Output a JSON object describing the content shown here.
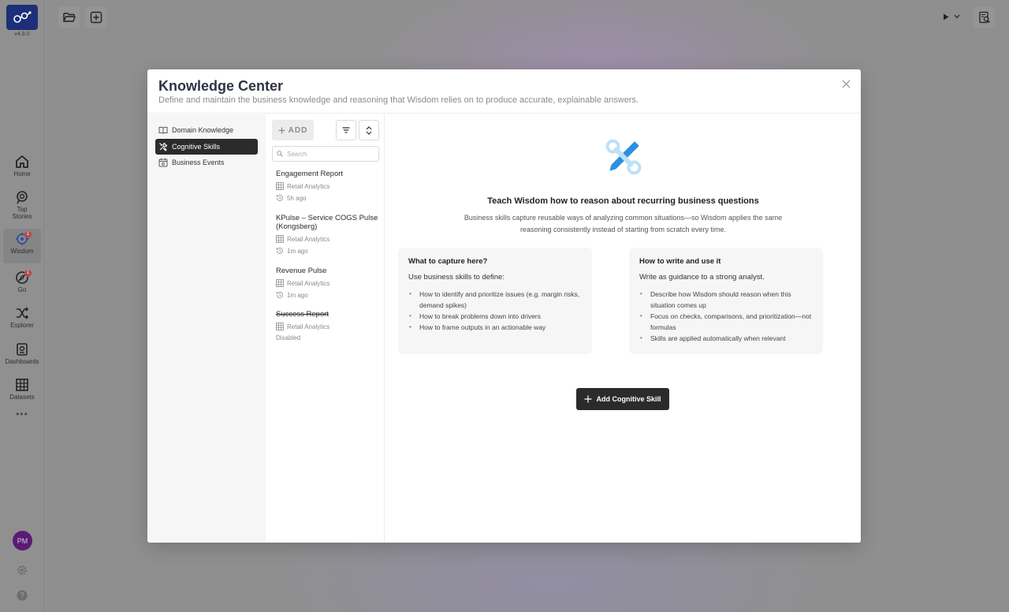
{
  "app": {
    "version": "v4.9.0",
    "rail": [
      {
        "label": "Home",
        "icon": "home-icon"
      },
      {
        "label": "Top Stories",
        "icon": "stories-icon"
      },
      {
        "label": "Wisdom",
        "icon": "wisdom-icon",
        "active": true,
        "badge": "1"
      },
      {
        "label": "Go",
        "icon": "compass-icon",
        "badge": "1"
      },
      {
        "label": "Explorer",
        "icon": "shuffle-icon"
      },
      {
        "label": "Dashboards",
        "icon": "dashboard-icon"
      },
      {
        "label": "Datasets",
        "icon": "table-icon"
      }
    ],
    "more": "•••",
    "avatar_initials": "PM"
  },
  "modal": {
    "title": "Knowledge Center",
    "subtitle": "Define and maintain the business knowledge and reasoning that Wisdom relies on to produce accurate, explainable answers.",
    "nav": [
      {
        "label": "Domain Knowledge",
        "icon": "book-icon"
      },
      {
        "label": "Cognitive Skills",
        "icon": "tools-icon",
        "active": true
      },
      {
        "label": "Business Events",
        "icon": "calendar-icon"
      }
    ],
    "list": {
      "add_label": "ADD",
      "search_placeholder": "Search",
      "items": [
        {
          "title": "Engagement Report",
          "dataset": "Retail Analytics",
          "status": "5h ago"
        },
        {
          "title": "KPulse – Service COGS Pulse (Kongsberg)",
          "dataset": "Retail Analytics",
          "status": "1m ago"
        },
        {
          "title": "Revenue Pulse",
          "dataset": "Retail Analytics",
          "status": "1m ago"
        },
        {
          "title": "Success Report",
          "dataset": "Retail Analytics",
          "status": "Disabled"
        }
      ]
    },
    "content": {
      "title": "Teach Wisdom how to reason about recurring business questions",
      "description": "Business skills capture reusable ways of analyzing common situations—so Wisdom applies the same reasoning consistently instead of starting from scratch every time.",
      "cards": [
        {
          "title": "What to capture here?",
          "lead": "Use business skills to define:",
          "bullets": [
            "How to identify and prioritize issues (e.g. margin risks, demand spikes)",
            "How to break problems down into drivers",
            "How to frame outputs in an actionable way"
          ]
        },
        {
          "title": "How to write and use it",
          "lead": "Write as guidance to a strong analyst.",
          "bullets": [
            "Describe how Wisdom should reason when this situation comes up",
            "Focus on checks, comparisons, and prioritization—not formulas",
            "Skills are applied automatically when relevant"
          ]
        }
      ],
      "primary_button": "Add Cognitive Skill"
    }
  },
  "colors": {
    "brand": "#1d2f78",
    "active_nav": "#2b2b2b",
    "hero_blue": "#2d8fe0",
    "hero_light": "#bfe0f8"
  }
}
